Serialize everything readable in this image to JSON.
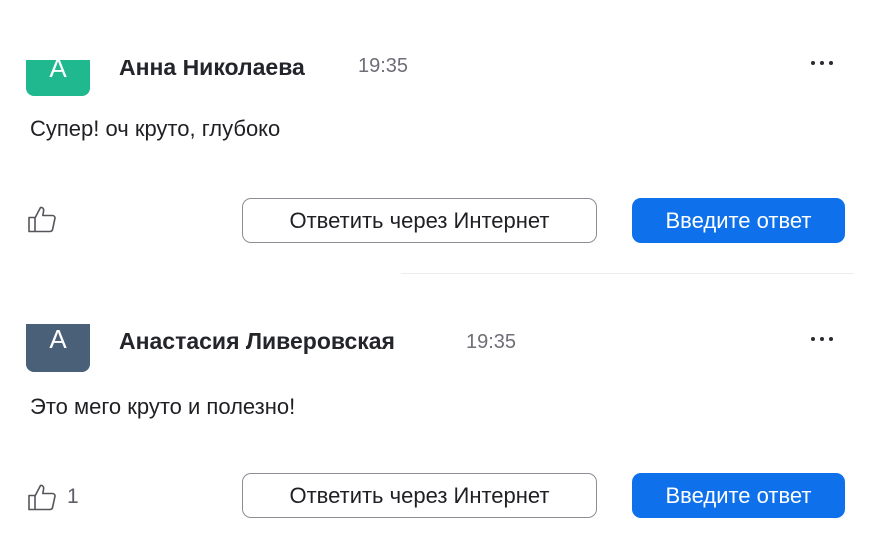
{
  "messages": [
    {
      "avatar_letter": "A",
      "avatar_color": "#1fb88f",
      "author": "Анна Николаева",
      "time": "19:35",
      "text": "Супер! оч круто, глубоко",
      "like_count": "",
      "reply_web_label": "Ответить через Интернет",
      "enter_reply_label": "Введите ответ",
      "more_icon": "more-horizontal-icon",
      "like_icon": "thumbs-up-icon"
    },
    {
      "avatar_letter": "A",
      "avatar_color": "#4a6079",
      "author": "Анастасия Ливеровская",
      "time": "19:35",
      "text": "Это мего круто и полезно!",
      "like_count": "1",
      "reply_web_label": "Ответить через Интернет",
      "enter_reply_label": "Введите ответ",
      "more_icon": "more-horizontal-icon",
      "like_icon": "thumbs-up-icon"
    }
  ],
  "colors": {
    "primary_button": "#0e71eb",
    "divider": "#ececef",
    "secondary_text": "#6e6e78"
  }
}
